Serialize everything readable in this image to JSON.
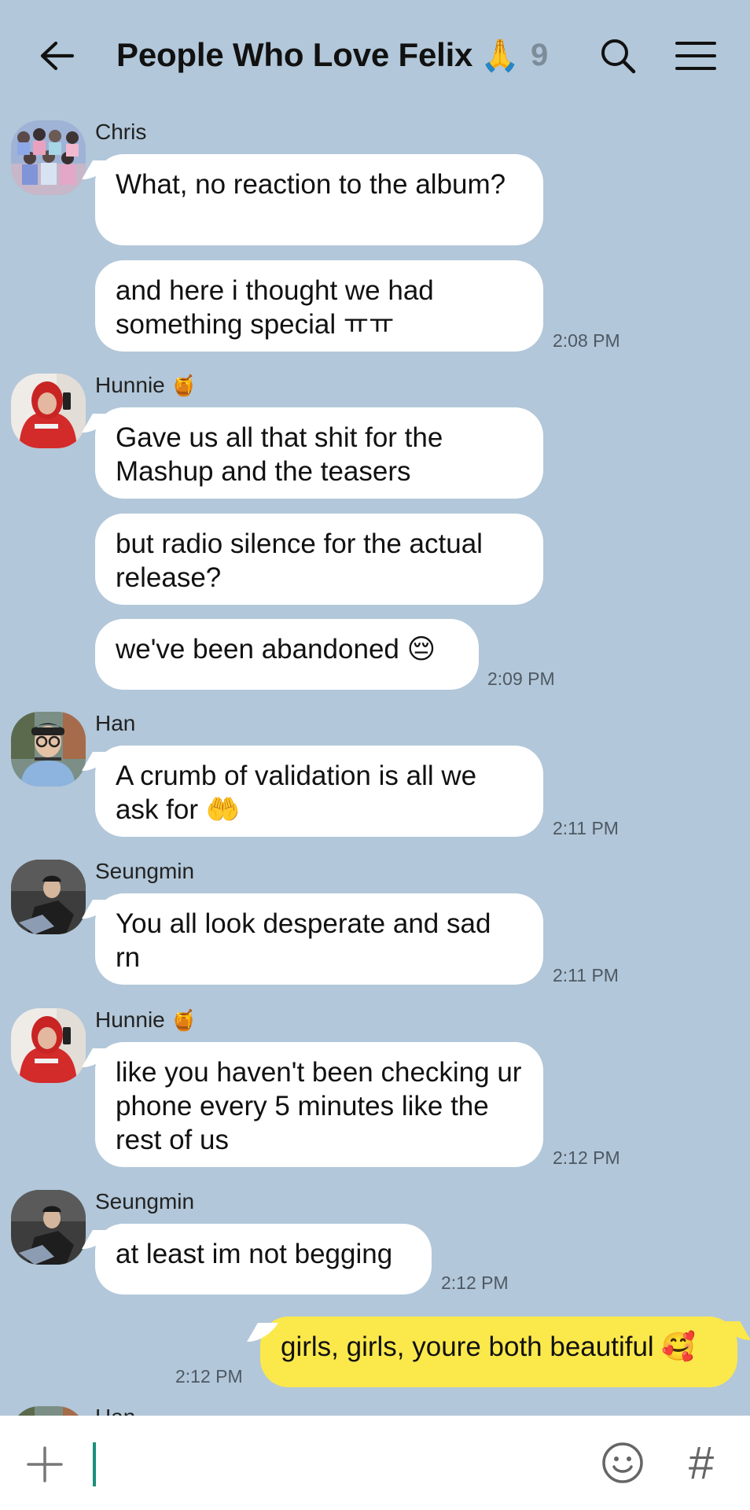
{
  "header": {
    "title": "People Who Love Felix",
    "title_emoji": "🙏",
    "member_count": "9",
    "back_icon": "arrow-left-icon",
    "search_icon": "search-icon",
    "menu_icon": "hamburger-menu-icon"
  },
  "messages": [
    {
      "sender": "Chris",
      "badge": "",
      "bubbles": [
        "What, no reaction to the album?",
        "and here i thought we had something special ㅠㅠ"
      ],
      "time": "2:08 PM"
    },
    {
      "sender": "Hunnie",
      "badge": "🍯",
      "bubbles": [
        "Gave us all that shit for the Mashup and the teasers",
        "but radio silence for the actual release?",
        "we've been abandoned 😔"
      ],
      "time": "2:09 PM"
    },
    {
      "sender": "Han",
      "badge": "",
      "bubbles": [
        "A crumb of validation is all we ask for 🤲"
      ],
      "time": "2:11 PM"
    },
    {
      "sender": "Seungmin",
      "badge": "",
      "bubbles": [
        "You all look desperate and sad rn"
      ],
      "time": "2:11 PM"
    },
    {
      "sender": "Hunnie",
      "badge": "🍯",
      "bubbles": [
        "like you haven't been checking ur phone every 5 minutes like the rest of us"
      ],
      "time": "2:12 PM"
    },
    {
      "sender": "Seungmin",
      "badge": "",
      "bubbles": [
        "at least im not begging"
      ],
      "time": "2:12 PM"
    }
  ],
  "my_message": {
    "text": "girls, girls, youre both beautiful 🥰",
    "time": "2:12 PM"
  },
  "partial_next": {
    "sender": "Han"
  },
  "input_bar": {
    "placeholder": "",
    "value": "",
    "plus_icon": "plus-icon",
    "emoji_icon": "smiley-icon",
    "hash_label": "#"
  },
  "colors": {
    "background": "#b2c7d9",
    "my_bubble": "#fbe84b",
    "other_bubble": "#ffffff",
    "caret": "#1a8f7a"
  }
}
